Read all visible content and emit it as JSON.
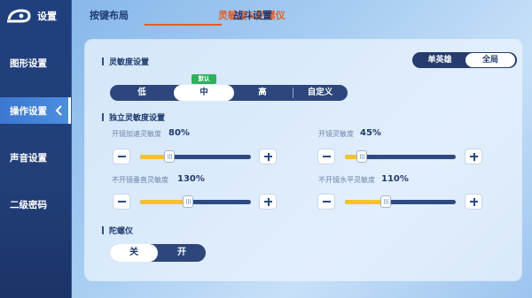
{
  "app": {
    "title": "设置"
  },
  "sidebar": {
    "items": [
      {
        "label": "图形设置",
        "active": false
      },
      {
        "label": "操作设置",
        "active": true
      },
      {
        "label": "声音设置",
        "active": false
      },
      {
        "label": "二级密码",
        "active": false
      }
    ]
  },
  "tabs": [
    {
      "label": "按键布局",
      "active": false
    },
    {
      "label": "灵敏度&陀螺仪",
      "active": true
    },
    {
      "label": "战斗设置",
      "active": false
    }
  ],
  "sensitivity": {
    "section_title": "灵敏度设置",
    "scope_options": [
      "单英雄",
      "全局"
    ],
    "scope_selected": "全局",
    "level_options": [
      "低",
      "中",
      "高",
      "自定义"
    ],
    "level_selected": "中",
    "default_badge": "默认"
  },
  "independent": {
    "section_title": "独立灵敏度设置",
    "sliders": [
      {
        "label": "开镜加速灵敏度",
        "value_text": "80%",
        "value": 80,
        "min": 0,
        "max": 300
      },
      {
        "label": "开镜灵敏度",
        "value_text": "45%",
        "value": 45,
        "min": 0,
        "max": 300
      },
      {
        "label": "不开镜垂直灵敏度",
        "value_text": "130%",
        "value": 130,
        "min": 0,
        "max": 300
      },
      {
        "label": "不开镜水平灵敏度",
        "value_text": "110%",
        "value": 110,
        "min": 0,
        "max": 300
      }
    ]
  },
  "gyro": {
    "section_title": "陀螺仪",
    "options": [
      "关",
      "开"
    ],
    "selected": "关"
  },
  "colors": {
    "accent": "#e45d25",
    "slider_fill": "#f5c22e",
    "badge": "#2fb05b",
    "navy": "#2d477c"
  }
}
